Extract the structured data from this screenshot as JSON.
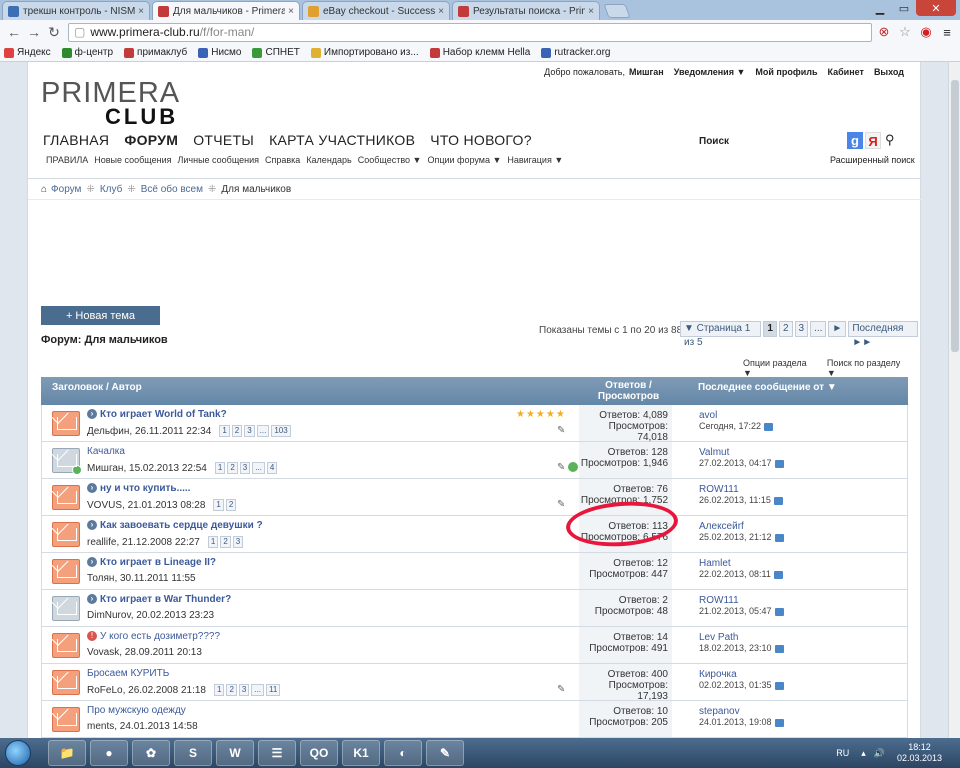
{
  "browser": {
    "tabs": [
      {
        "title": "трекшн контроль - NISM",
        "color": "#3d6fb5",
        "active": false
      },
      {
        "title": "Для мальчиков - Primera",
        "color": "#c23a3a",
        "active": true
      },
      {
        "title": "eBay checkout - Success",
        "color": "#e0a030",
        "active": false
      },
      {
        "title": "Результаты поиска - Prim",
        "color": "#c23a3a",
        "active": false
      }
    ],
    "url_host": "www.primera-club.ru",
    "url_path": "/f/for-man/",
    "bookmarks": [
      "Яндекс",
      "ф-центр",
      "примаклуб",
      "Нисмо",
      "СПНЕТ",
      "Импортировано из...",
      "Набор клемм Hella",
      "rutracker.org"
    ]
  },
  "site": {
    "welcome": "Добро пожаловать,",
    "user": "Мишган",
    "notifications": "Уведомления ▼",
    "profile": "Мой профиль",
    "cabinet": "Кабинет",
    "logout": "Выход",
    "logo_line1": "PRIMERA",
    "logo_line2": "CLUB",
    "nav": [
      "ГЛАВНАЯ",
      "ФОРУМ",
      "ОТЧЕТЫ",
      "КАРТА УЧАСТНИКОВ",
      "ЧТО НОВОГО?"
    ],
    "subnav": [
      "ПРАВИЛА",
      "Новые сообщения",
      "Личные сообщения",
      "Справка",
      "Календарь",
      "Сообщество ▼",
      "Опции форума ▼",
      "Навигация ▼"
    ],
    "search_label": "Поиск",
    "adv_search": "Расширенный поиск",
    "breadcrumb": [
      "Форум",
      "Клуб",
      "Всё обо всем",
      "Для мальчиков"
    ]
  },
  "forum": {
    "new_thread": "+ Новая тема",
    "title": "Форум: Для мальчиков",
    "shown": "Показаны темы с 1 по 20 из 88",
    "pager": [
      "▼ Страница 1 из 5",
      "1",
      "2",
      "3",
      "...",
      "►",
      "Последняя ►►"
    ],
    "options": [
      "Опции раздела ▼",
      "Поиск по разделу ▼"
    ],
    "col_title": "Заголовок / Автор",
    "col_stats_1": "Ответов /",
    "col_stats_2": "Просмотров",
    "col_last": "Последнее сообщение от ▼",
    "threads": [
      {
        "title": "Кто играет World of Tank?",
        "bold": true,
        "prefix": "◆",
        "author": "Дельфин, 26.11.2011 22:34",
        "pages": [
          "1",
          "2",
          "3",
          "...",
          "103"
        ],
        "replies": "Ответов: 4,089",
        "views": "Просмотров: 74,018",
        "last_user": "avol",
        "last_date": "Сегодня, 17:22",
        "stars": "★★★★★",
        "icons": "✎",
        "grey": false
      },
      {
        "title": "Качалка",
        "bold": false,
        "prefix": "",
        "author": "Мишган, 15.02.2013 22:54",
        "pages": [
          "1",
          "2",
          "3",
          "...",
          "4"
        ],
        "replies": "Ответов: 128",
        "views": "Просмотров: 1,946",
        "last_user": "Valmut",
        "last_date": "27.02.2013, 04:17",
        "stars": "",
        "icons": "✎",
        "grey": true
      },
      {
        "title": "ну и что купить.....",
        "bold": true,
        "prefix": "◆",
        "author": "VOVUS, 21.01.2013 08:28",
        "pages": [
          "1",
          "2"
        ],
        "replies": "Ответов: 76",
        "views": "Просмотров: 1,752",
        "last_user": "ROW111",
        "last_date": "26.02.2013, 11:15",
        "stars": "",
        "icons": "✎",
        "grey": false
      },
      {
        "title": "Как завоевать сердце девушки ?",
        "bold": true,
        "prefix": "◆",
        "author": "reallife, 21.12.2008 22:27",
        "pages": [
          "1",
          "2",
          "3"
        ],
        "replies": "Ответов: 113",
        "views": "Просмотров: 6,576",
        "last_user": "Алексейrf",
        "last_date": "25.02.2013, 21:12",
        "stars": "",
        "icons": "",
        "grey": false
      },
      {
        "title": "Кто играет в Lineage II?",
        "bold": true,
        "prefix": "◆",
        "author": "Толян, 30.11.2011 11:55",
        "pages": [],
        "replies": "Ответов: 12",
        "views": "Просмотров: 447",
        "last_user": "Hamlet",
        "last_date": "22.02.2013, 08:11",
        "stars": "",
        "icons": "",
        "grey": false
      },
      {
        "title": "Кто играет в War Thunder?",
        "bold": true,
        "prefix": "◆",
        "author": "DimNurov, 20.02.2013 23:23",
        "pages": [],
        "replies": "Ответов: 2",
        "views": "Просмотров: 48",
        "last_user": "ROW111",
        "last_date": "21.02.2013, 05:47",
        "stars": "",
        "icons": "",
        "grey": true
      },
      {
        "title": "У кого есть дозиметр????",
        "bold": false,
        "prefix": "!",
        "author": "Vovask, 28.09.2011 20:13",
        "pages": [],
        "replies": "Ответов: 14",
        "views": "Просмотров: 491",
        "last_user": "Lev Path",
        "last_date": "18.02.2013, 23:10",
        "stars": "",
        "icons": "",
        "grey": false
      },
      {
        "title": "Бросаем КУРИТЬ",
        "bold": false,
        "prefix": "",
        "author": "RoFeLo, 26.02.2008 21:18",
        "pages": [
          "1",
          "2",
          "3",
          "...",
          "11"
        ],
        "replies": "Ответов: 400",
        "views": "Просмотров: 17,193",
        "last_user": "Кирочка",
        "last_date": "02.02.2013, 01:35",
        "stars": "",
        "icons": "✎",
        "grey": false
      },
      {
        "title": "Про мужскую одежду",
        "bold": false,
        "prefix": "",
        "author": "ments, 24.01.2013 14:58",
        "pages": [],
        "replies": "Ответов: 10",
        "views": "Просмотров: 205",
        "last_user": "stepanov",
        "last_date": "24.01.2013, 19:08",
        "stars": "",
        "icons": "",
        "grey": false
      }
    ]
  },
  "taskbar": {
    "apps": [
      "📁",
      "●",
      "✿",
      "S",
      "W",
      "☰",
      "QO",
      "K1",
      "◐",
      "✎"
    ],
    "lang": "RU",
    "time": "18:12",
    "date": "02.03.2013"
  }
}
